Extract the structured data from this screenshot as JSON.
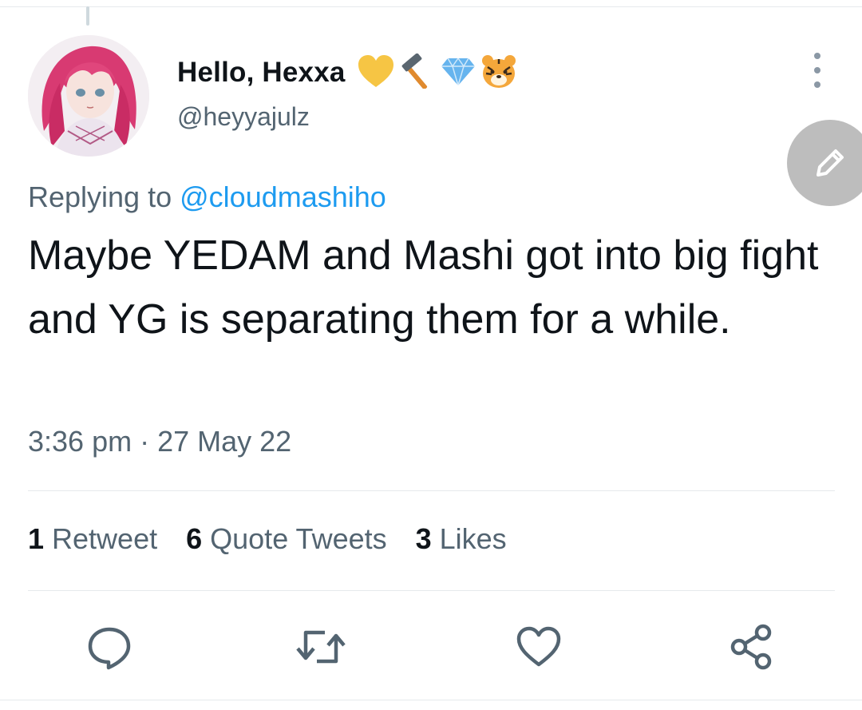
{
  "author": {
    "display_name": "Hello, Hexxa",
    "name_emojis": [
      "yellow-heart",
      "hammer",
      "gem",
      "tiger-face"
    ],
    "handle": "@heyyajulz"
  },
  "reply": {
    "prefix": "Replying to",
    "mention": "@cloudmashiho"
  },
  "tweet": {
    "text": "Maybe YEDAM and Mashi got into big fight and YG is separating them for a while.",
    "timestamp": "3:36 pm · 27 May 22"
  },
  "stats": [
    {
      "count": "1",
      "label": "Retweet"
    },
    {
      "count": "6",
      "label": "Quote Tweets"
    },
    {
      "count": "3",
      "label": "Likes"
    }
  ],
  "actions": [
    "reply-icon",
    "retweet-icon",
    "like-icon",
    "share-icon"
  ],
  "colors": {
    "accent": "#1d9bf0",
    "secondary_text": "#536471",
    "primary_text": "#0f1419",
    "divider": "#e6e9ec",
    "fab": "#bdbdbd"
  }
}
